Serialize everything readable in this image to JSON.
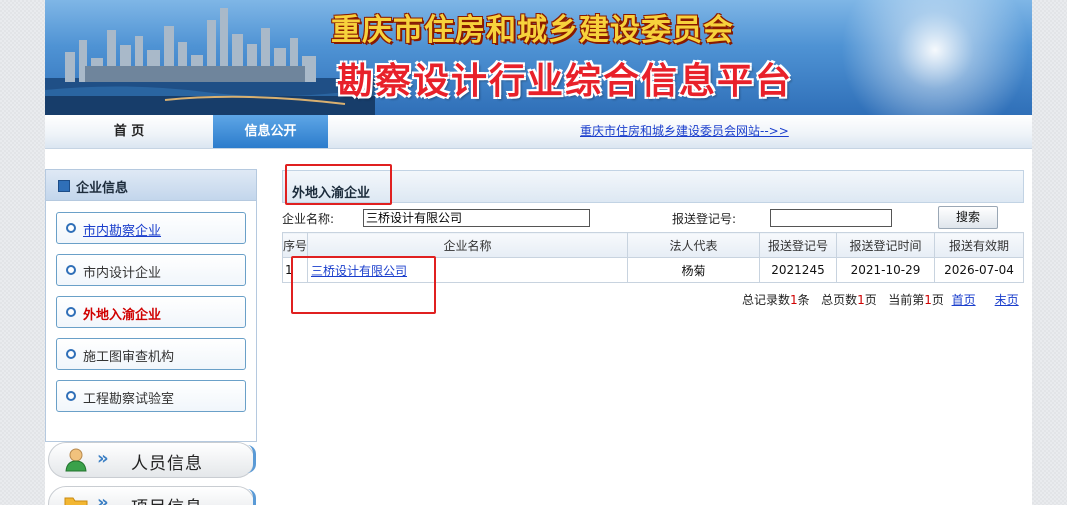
{
  "banner": {
    "title_line1": "重庆市住房和城乡建设委员会",
    "title_line2": "勘察设计行业综合信息平台"
  },
  "nav": {
    "home": "首 页",
    "info": "信息公开",
    "link": "重庆市住房和城乡建设委员会网站-->>"
  },
  "sidebar": {
    "header": "企业信息",
    "items": [
      {
        "label": "市内勘察企业"
      },
      {
        "label": "市内设计企业"
      },
      {
        "label": "外地入渝企业"
      },
      {
        "label": "施工图审查机构"
      },
      {
        "label": "工程勘察试验室"
      }
    ],
    "pills": [
      {
        "label": "人员信息",
        "icon": "person-icon"
      },
      {
        "label": "项目信息",
        "icon": "folder-icon"
      }
    ]
  },
  "main": {
    "title": "外地入渝企业",
    "search": {
      "company_label": "企业名称:",
      "company_value": "三桥设计有限公司",
      "reg_label": "报送登记号:",
      "reg_value": "",
      "button": "搜索"
    },
    "table": {
      "headers": [
        "序号",
        "企业名称",
        "法人代表",
        "报送登记号",
        "报送登记时间",
        "报送有效期"
      ],
      "rows": [
        {
          "idx": "1",
          "name": "三桥设计有限公司",
          "rep": "杨菊",
          "reg_no": "2021245",
          "reg_time": "2021-10-29",
          "valid": "2026-07-04"
        }
      ]
    },
    "pager": {
      "total_records_pre": "总记录数",
      "total_records": "1",
      "total_records_post": "条",
      "total_pages_pre": "总页数",
      "total_pages": "1",
      "total_pages_post": "页",
      "current_pre": "当前第",
      "current": "1",
      "current_post": "页",
      "first": "首页",
      "last": "末页"
    }
  },
  "colors": {
    "highlight_box": "#e02020",
    "link": "#1a3ecc",
    "active_item": "#d00000"
  }
}
